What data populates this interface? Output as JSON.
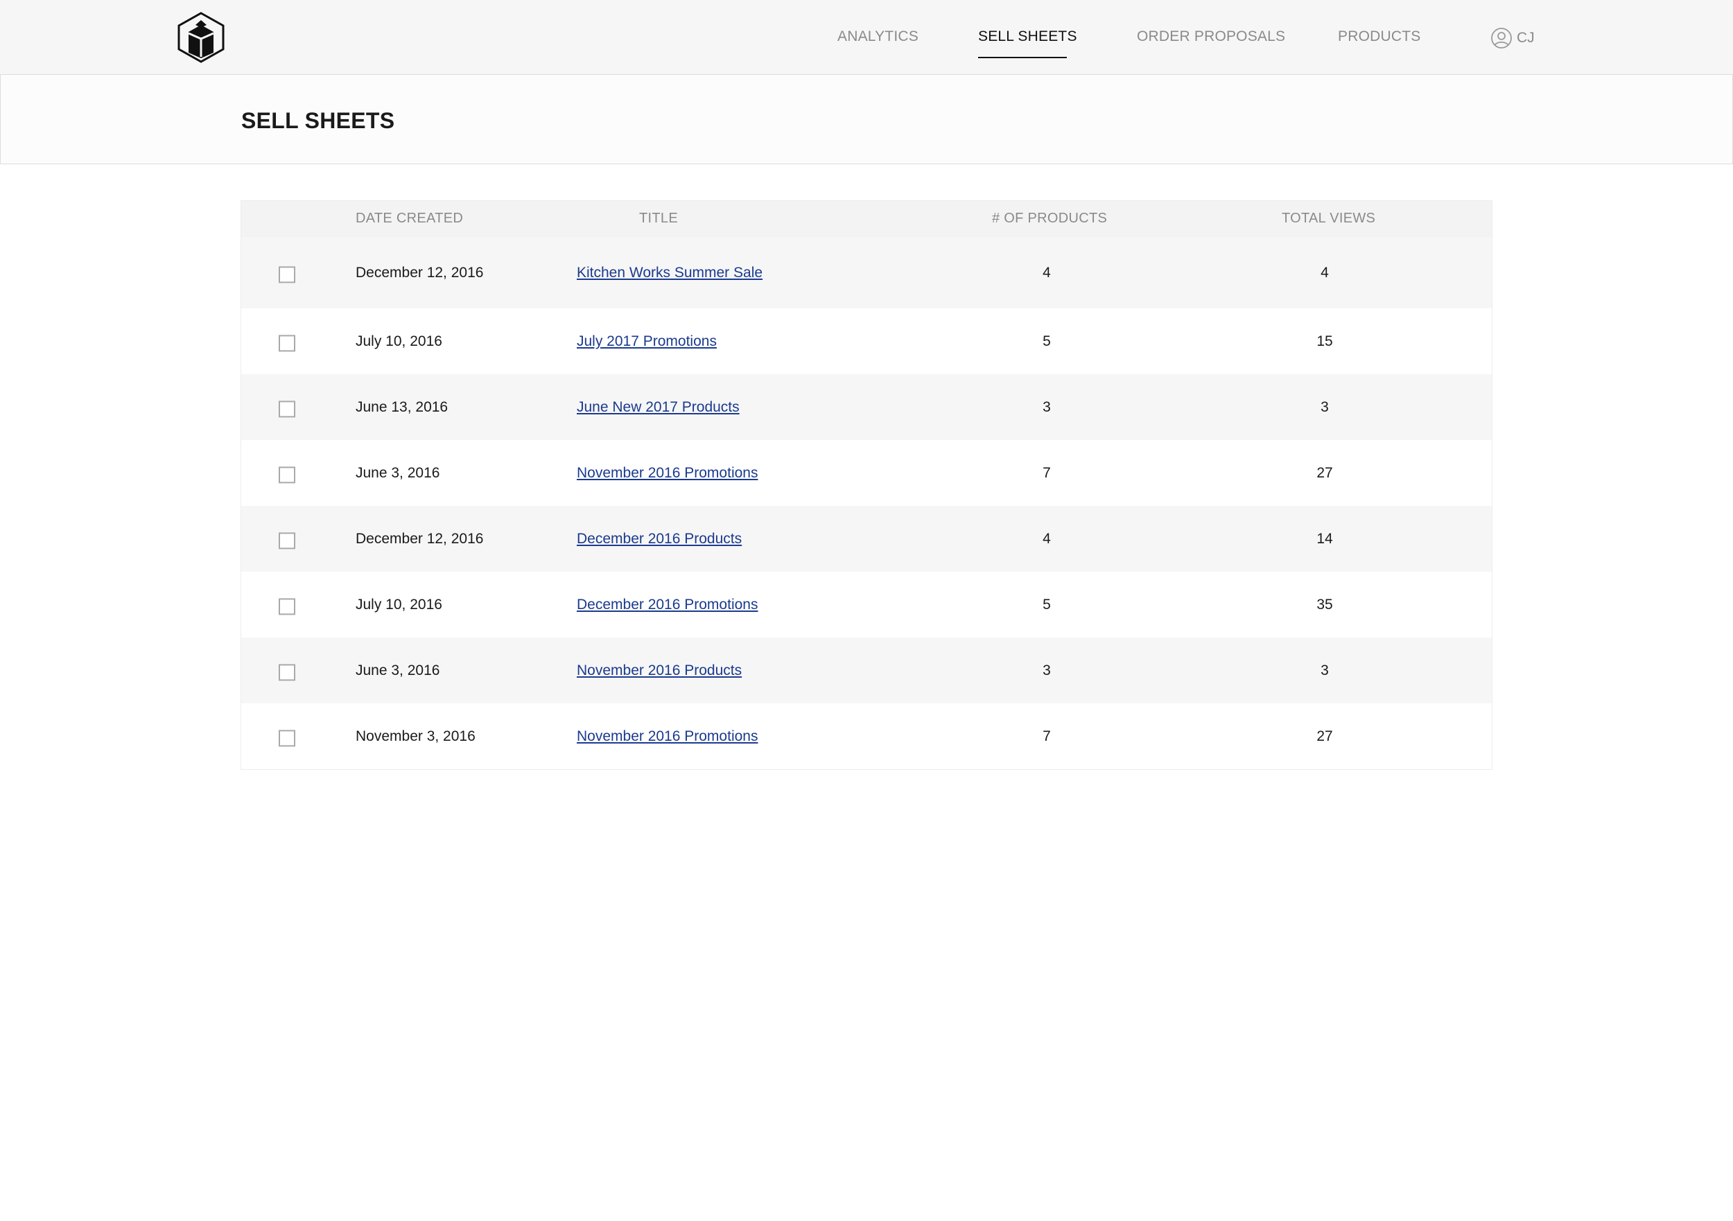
{
  "nav": {
    "items": [
      {
        "label": "ANALYTICS",
        "active": false
      },
      {
        "label": "SELL SHEETS",
        "active": true
      },
      {
        "label": "ORDER PROPOSALS",
        "active": false
      },
      {
        "label": "PRODUCTS",
        "active": false
      }
    ],
    "user_initials": "CJ"
  },
  "page": {
    "title": "SELL SHEETS"
  },
  "table": {
    "columns": [
      "DATE CREATED",
      "TITLE",
      "# OF PRODUCTS",
      "TOTAL VIEWS"
    ],
    "rows": [
      {
        "date": "December 12, 2016",
        "title": "Kitchen Works Summer Sale",
        "products": "4",
        "views": "4"
      },
      {
        "date": "July 10, 2016",
        "title": "July 2017 Promotions",
        "products": "5",
        "views": "15"
      },
      {
        "date": "June 13, 2016",
        "title": "June New 2017 Products",
        "products": "3",
        "views": "3"
      },
      {
        "date": "June 3, 2016",
        "title": "November 2016 Promotions",
        "products": "7",
        "views": "27"
      },
      {
        "date": "December 12, 2016",
        "title": "December 2016 Products",
        "products": "4",
        "views": "14"
      },
      {
        "date": "July 10, 2016",
        "title": "December 2016 Promotions",
        "products": "5",
        "views": "35"
      },
      {
        "date": "June 3, 2016",
        "title": "November 2016 Products",
        "products": "3",
        "views": "3"
      },
      {
        "date": "November 3, 2016",
        "title": "November 2016 Promotions",
        "products": "7",
        "views": "27"
      }
    ]
  },
  "colors": {
    "link": "#1b3a8f",
    "nav_inactive": "#8a8a8a",
    "nav_active": "#111111",
    "row_alt": "#f6f6f6"
  },
  "icons": {
    "logo": "building-hexagon-logo",
    "user": "user-circle-icon",
    "checkbox": "checkbox-unchecked"
  }
}
